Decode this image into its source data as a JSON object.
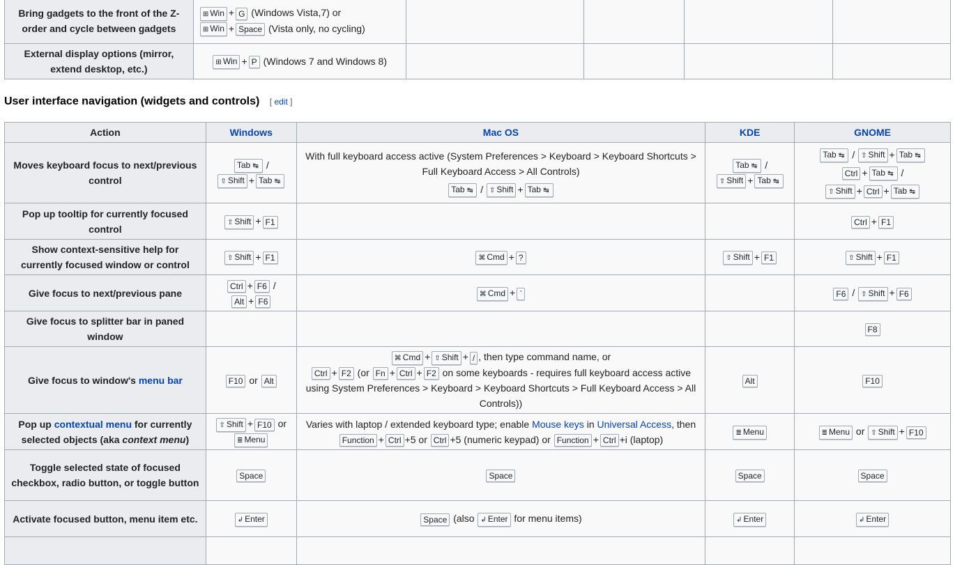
{
  "top_table": {
    "rows": [
      {
        "action": "Bring gadgets to the front of the Z-order and cycle between gadgets",
        "win_line1_k1": "Win",
        "win_line1_k2": "G",
        "win_line1_note": "(Windows Vista,7) or",
        "win_line2_k1": "Win",
        "win_line2_k2": "Space",
        "win_line2_note": "(Vista only, no cycling)"
      },
      {
        "action": "External display options (mirror, extend desktop, etc.)",
        "win_k1": "Win",
        "win_k2": "P",
        "win_note": "(Windows 7 and Windows 8)"
      }
    ]
  },
  "section": {
    "title": "User interface navigation (widgets and controls)",
    "edit_open": "[",
    "edit_label": "edit",
    "edit_close": "]"
  },
  "table": {
    "headers": {
      "action": "Action",
      "windows": "Windows",
      "mac": "Mac OS",
      "kde": "KDE",
      "gnome": "GNOME"
    },
    "symbols": {
      "win": "⊞",
      "shift": "⇧",
      "cmd": "⌘",
      "enter": "↲",
      "menu": "≣",
      "tab": "↹"
    },
    "words": {
      "slash": "/",
      "or": "or",
      "plus": "+"
    },
    "rows": {
      "r1": {
        "action": "Moves keyboard focus to next/previous control",
        "mac_text": "With full keyboard access active (System Preferences > Keyboard > Keyboard Shortcuts > Full Keyboard Access > All Controls)"
      },
      "r2": {
        "action": "Pop up tooltip for currently focused control"
      },
      "r3": {
        "action": "Show context-sensitive help for currently focused window or control"
      },
      "r4": {
        "action": "Give focus to next/previous pane"
      },
      "r5": {
        "action": "Give focus to splitter bar in paned window"
      },
      "r6": {
        "action_pre": "Give focus to window's",
        "action_link": "menu bar",
        "mac_then": ", then type command name, or",
        "mac_or1": "(or",
        "mac_tail": "on some keyboards - requires full keyboard access active using System Preferences > Keyboard > Keyboard Shortcuts > Full Keyboard Access > All Controls))"
      },
      "r7": {
        "action_pre": "Pop up",
        "action_link": "contextual menu",
        "action_mid": "for currently selected objects (aka",
        "action_em": "context menu",
        "action_post": ")",
        "mac_pre": "Varies with laptop / extended keyboard type; enable",
        "mac_link1": "Mouse keys",
        "mac_in": "in",
        "mac_link2": "Universal Access",
        "mac_then": ", then",
        "mac_p5or": "+5 or",
        "mac_p5num": "+5 (numeric keypad) or",
        "mac_pi": "+i (laptop)"
      },
      "r8": {
        "action": "Toggle selected state of focused checkbox, radio button, or toggle button"
      },
      "r9": {
        "action": "Activate focused button, menu item etc.",
        "mac_also": "(also",
        "mac_post": "for menu items)"
      }
    },
    "keys": {
      "tab": "Tab",
      "shift": "Shift",
      "ctrl": "Ctrl",
      "alt": "Alt",
      "cmd": "Cmd",
      "f1": "F1",
      "f2": "F2",
      "f6": "F6",
      "f8": "F8",
      "f10": "F10",
      "q": "?",
      "backtick": "`",
      "fslash": "/",
      "fn": "Fn",
      "function": "Function",
      "space": "Space",
      "enter": "Enter",
      "menu": "Menu"
    }
  }
}
